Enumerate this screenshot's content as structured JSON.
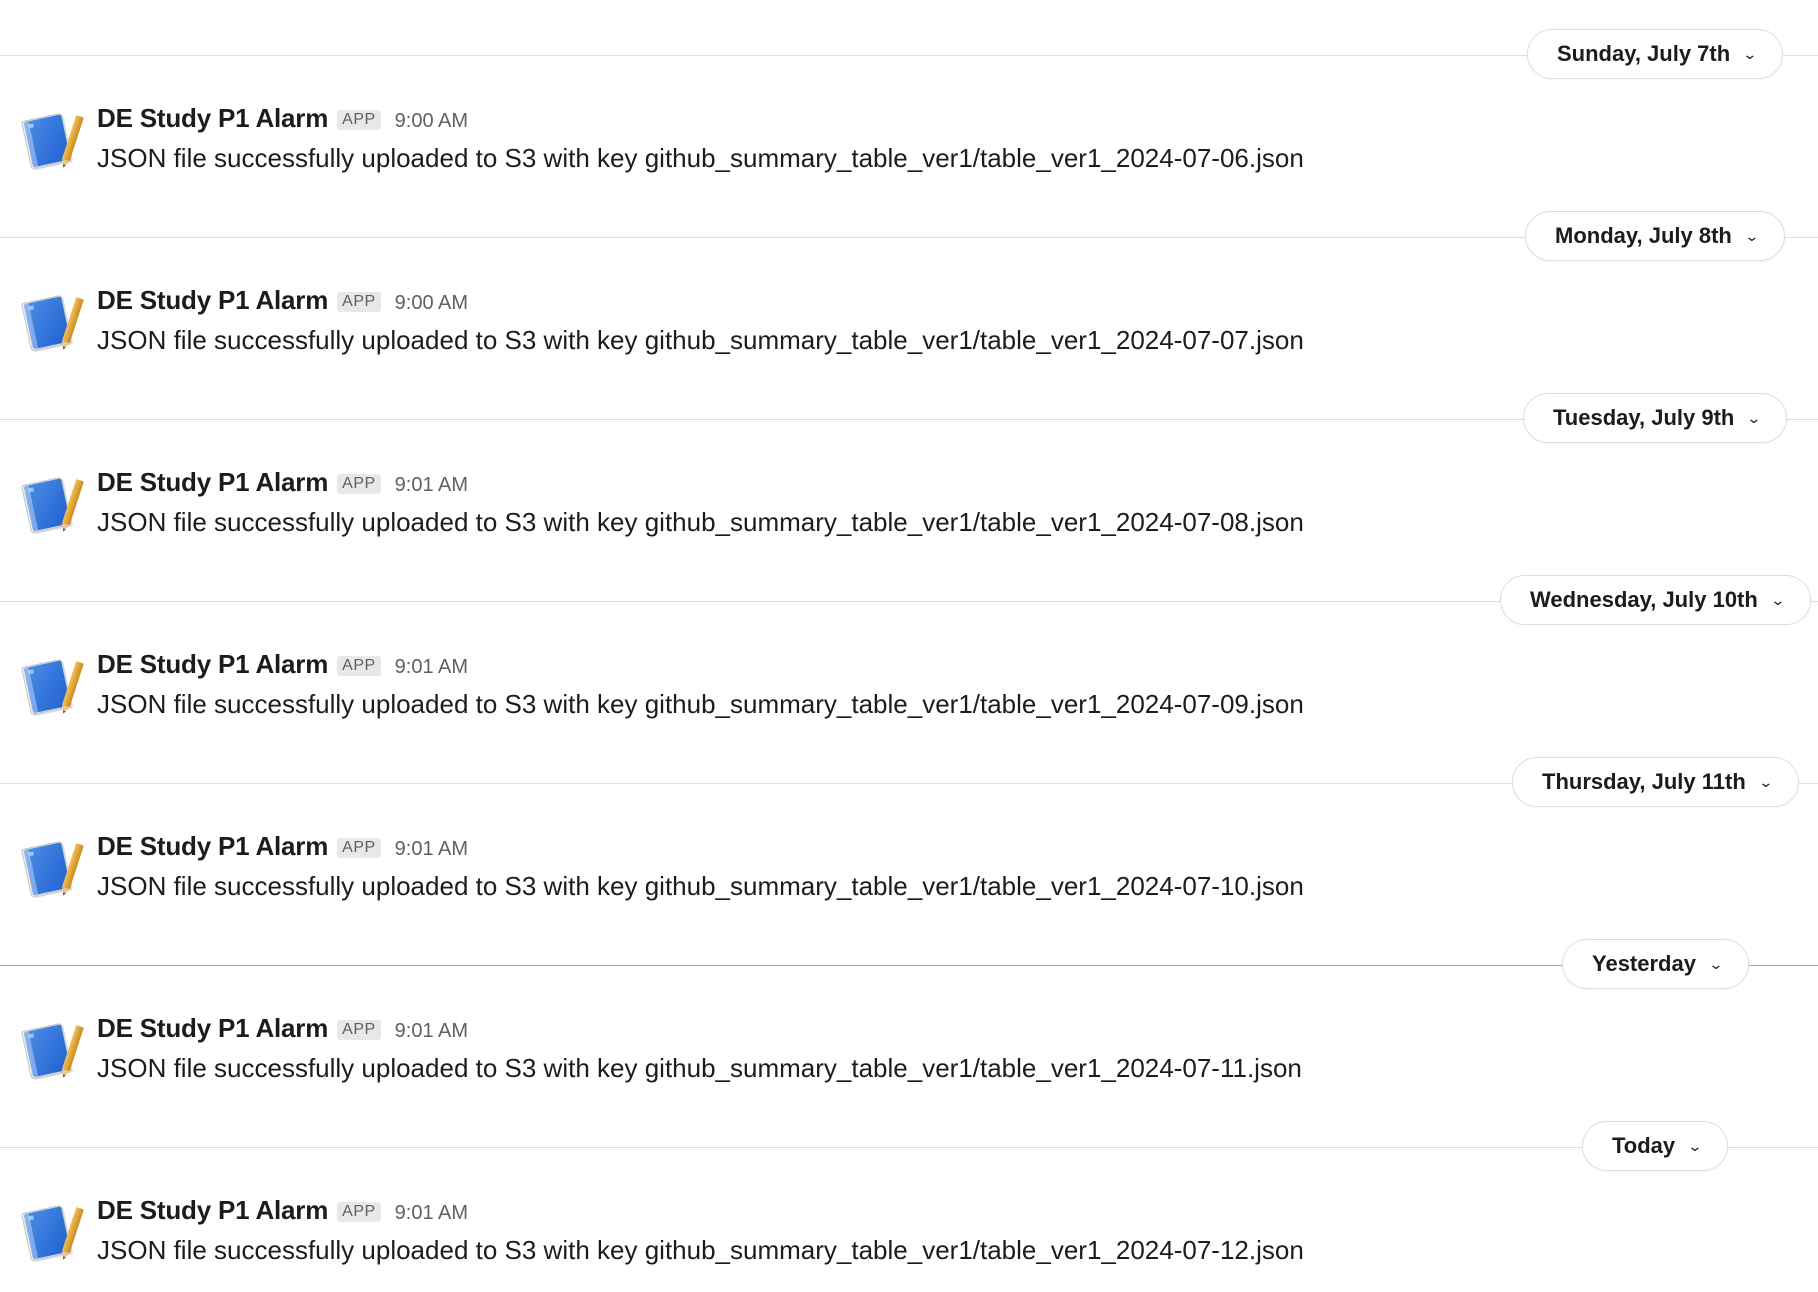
{
  "feed": {
    "days": [
      {
        "date_label": "Sunday, July 7th",
        "is_new": false,
        "message": {
          "sender": "DE Study P1 Alarm",
          "badge": "APP",
          "time": "9:00 AM",
          "text": "JSON file successfully uploaded to S3 with key github_summary_table_ver1/table_ver1_2024-07-06.json"
        }
      },
      {
        "date_label": "Monday, July 8th",
        "is_new": false,
        "message": {
          "sender": "DE Study P1 Alarm",
          "badge": "APP",
          "time": "9:00 AM",
          "text": "JSON file successfully uploaded to S3 with key github_summary_table_ver1/table_ver1_2024-07-07.json"
        }
      },
      {
        "date_label": "Tuesday, July 9th",
        "is_new": false,
        "message": {
          "sender": "DE Study P1 Alarm",
          "badge": "APP",
          "time": "9:01 AM",
          "text": "JSON file successfully uploaded to S3 with key github_summary_table_ver1/table_ver1_2024-07-08.json"
        }
      },
      {
        "date_label": "Wednesday, July 10th",
        "is_new": false,
        "message": {
          "sender": "DE Study P1 Alarm",
          "badge": "APP",
          "time": "9:01 AM",
          "text": "JSON file successfully uploaded to S3 with key github_summary_table_ver1/table_ver1_2024-07-09.json"
        }
      },
      {
        "date_label": "Thursday, July 11th",
        "is_new": false,
        "message": {
          "sender": "DE Study P1 Alarm",
          "badge": "APP",
          "time": "9:01 AM",
          "text": "JSON file successfully uploaded to S3 with key github_summary_table_ver1/table_ver1_2024-07-10.json"
        }
      },
      {
        "date_label": "Yesterday",
        "is_new": true,
        "message": {
          "sender": "DE Study P1 Alarm",
          "badge": "APP",
          "time": "9:01 AM",
          "text": "JSON file successfully uploaded to S3 with key github_summary_table_ver1/table_ver1_2024-07-11.json"
        }
      },
      {
        "date_label": "Today",
        "is_new": false,
        "message": {
          "sender": "DE Study P1 Alarm",
          "badge": "APP",
          "time": "9:01 AM",
          "text": "JSON file successfully uploaded to S3 with key github_summary_table_ver1/table_ver1_2024-07-12.json"
        }
      }
    ],
    "chevron_icon": "chevron-down-icon",
    "avatar_icon": "notebook-app-icon",
    "colors": {
      "new_divider": "#e01e5a",
      "divider": "#dddddd",
      "text": "#1d1c1d",
      "muted": "#616061"
    }
  }
}
